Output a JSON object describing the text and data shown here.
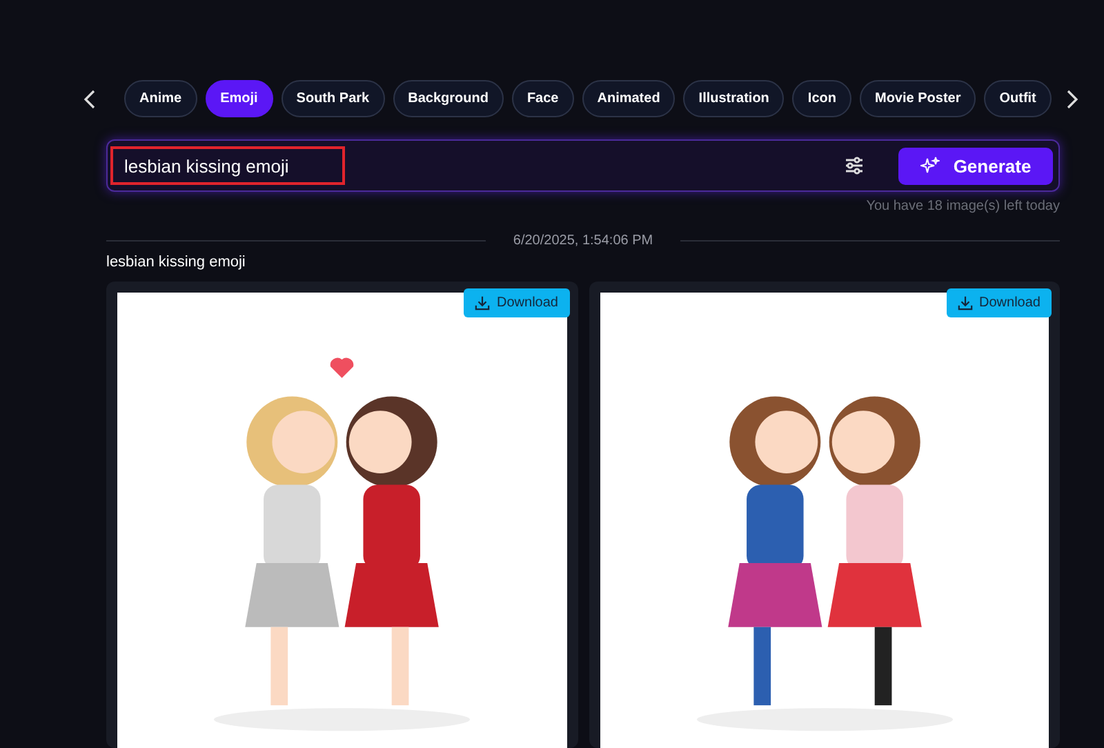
{
  "categories": [
    {
      "label": "Anime",
      "selected": false
    },
    {
      "label": "Emoji",
      "selected": true
    },
    {
      "label": "South Park",
      "selected": false
    },
    {
      "label": "Background",
      "selected": false
    },
    {
      "label": "Face",
      "selected": false
    },
    {
      "label": "Animated",
      "selected": false
    },
    {
      "label": "Illustration",
      "selected": false
    },
    {
      "label": "Icon",
      "selected": false
    },
    {
      "label": "Movie Poster",
      "selected": false
    },
    {
      "label": "Outfit",
      "selected": false
    }
  ],
  "prompt": {
    "value": "lesbian kissing emoji",
    "generate_label": "Generate",
    "quota": "You have 18 image(s) left today"
  },
  "history": {
    "timestamp": "6/20/2025, 1:54:06 PM",
    "prompt": "lesbian kissing emoji",
    "images": [
      {
        "kind": "picture",
        "download_label": "Download"
      },
      {
        "kind": "picture",
        "download_label": "Download"
      }
    ]
  }
}
